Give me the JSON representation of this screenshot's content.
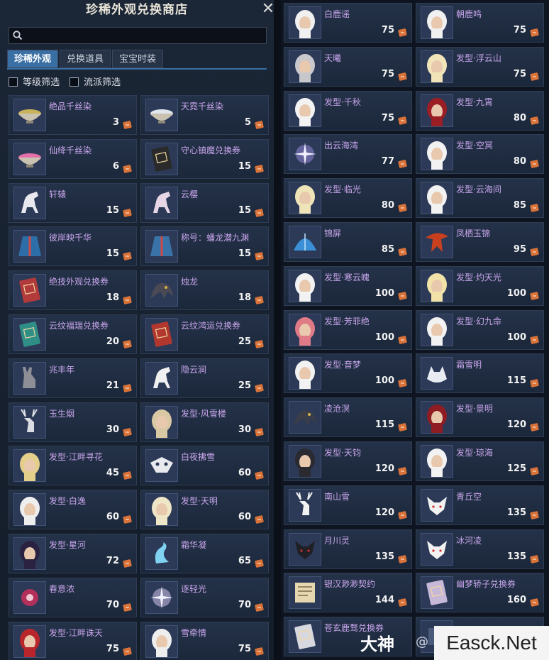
{
  "window": {
    "title": "珍稀外观兑换商店",
    "close_label": "✕"
  },
  "search": {
    "placeholder": ""
  },
  "tabs": [
    {
      "label": "珍稀外观",
      "active": true
    },
    {
      "label": "兑换道具",
      "active": false
    },
    {
      "label": "宝宝时装",
      "active": false
    }
  ],
  "filters": [
    {
      "label": "等级筛选",
      "checked": false
    },
    {
      "label": "流派筛选",
      "checked": false
    }
  ],
  "currency_icon": "ticket-icon",
  "left_items": [
    {
      "name": "绝品千丝染",
      "price": "3",
      "icon": "dye-bowl-icon",
      "color": "#c9b35a"
    },
    {
      "name": "天霓千丝染",
      "price": "5",
      "icon": "dye-bowl-icon",
      "color": "#dfe6ec"
    },
    {
      "name": "仙绛千丝染",
      "price": "6",
      "icon": "dye-bowl-icon",
      "color": "#e56fa8"
    },
    {
      "name": "守心镇魔兑换券",
      "price": "15",
      "icon": "coupon-icon",
      "color": "#2a2a2a"
    },
    {
      "name": "轩辕",
      "price": "15",
      "icon": "horse-icon",
      "color": "#e8e8ee"
    },
    {
      "name": "云樱",
      "price": "15",
      "icon": "horse-icon",
      "color": "#e6d6e6"
    },
    {
      "name": "彼岸映千华",
      "price": "15",
      "icon": "robe-icon",
      "color": "#2d6ea8"
    },
    {
      "name": "称号：蟠龙潜九渊",
      "price": "15",
      "icon": "robe-icon",
      "color": "#3a73a8"
    },
    {
      "name": "绝技外观兑换券",
      "price": "18",
      "icon": "coupon-icon",
      "color": "#b23a3a"
    },
    {
      "name": "烛龙",
      "price": "18",
      "icon": "dragon-icon",
      "color": "#4a4a55"
    },
    {
      "name": "云纹福瑞兑换券",
      "price": "20",
      "icon": "coupon-icon",
      "color": "#2f8f86"
    },
    {
      "name": "云纹鸿运兑换券",
      "price": "25",
      "icon": "coupon-icon",
      "color": "#b2382f"
    },
    {
      "name": "兆丰年",
      "price": "21",
      "icon": "donkey-icon",
      "color": "#8e8e96"
    },
    {
      "name": "隐云涧",
      "price": "25",
      "icon": "horse-icon",
      "color": "#f0f0f0"
    },
    {
      "name": "玉生烟",
      "price": "30",
      "icon": "deer-icon",
      "color": "#dcdde4"
    },
    {
      "name": "发型·风雪楼",
      "price": "30",
      "icon": "hair-icon",
      "color": "#d8c9a4"
    },
    {
      "name": "发型·江畔寻花",
      "price": "45",
      "icon": "hair-icon",
      "color": "#e3cf8a"
    },
    {
      "name": "白夜拂雪",
      "price": "60",
      "icon": "mask-icon",
      "color": "#e9eaee"
    },
    {
      "name": "发型·白逸",
      "price": "60",
      "icon": "hair-icon",
      "color": "#eeeeee"
    },
    {
      "name": "发型·天明",
      "price": "60",
      "icon": "hair-icon",
      "color": "#efe6c8"
    },
    {
      "name": "发型·星河",
      "price": "72",
      "icon": "hair-icon",
      "color": "#2a2240"
    },
    {
      "name": "霜华凝",
      "price": "65",
      "icon": "swan-icon",
      "color": "#7fd3f0"
    },
    {
      "name": "春意浓",
      "price": "70",
      "icon": "flower-icon",
      "color": "#b3305a"
    },
    {
      "name": "逐轻光",
      "price": "70",
      "icon": "sparkle-icon",
      "color": "#c3b8dc"
    },
    {
      "name": "发型·江畔诛天",
      "price": "75",
      "icon": "hair-icon",
      "color": "#b8262c"
    },
    {
      "name": "雪牵情",
      "price": "75",
      "icon": "hair-icon",
      "color": "#eeeeee"
    }
  ],
  "right_items": [
    {
      "name": "白鹿谣",
      "price": "75",
      "icon": "hair-icon",
      "color": "#f0f0f0"
    },
    {
      "name": "朝鹿鸣",
      "price": "75",
      "icon": "hair-icon",
      "color": "#f0f0f0"
    },
    {
      "name": "天曦",
      "price": "75",
      "icon": "hair-icon",
      "color": "#c8c8cc"
    },
    {
      "name": "发型·浮云山",
      "price": "75",
      "icon": "hair-icon",
      "color": "#f0e4b8"
    },
    {
      "name": "发型·千秋",
      "price": "75",
      "icon": "hair-icon",
      "color": "#f2f2f2"
    },
    {
      "name": "发型·九霄",
      "price": "80",
      "icon": "hair-icon",
      "color": "#9a1e24"
    },
    {
      "name": "出云海湾",
      "price": "77",
      "icon": "sparkle-icon",
      "color": "#8a7fc8"
    },
    {
      "name": "发型·空冥",
      "price": "80",
      "icon": "hair-icon",
      "color": "#f2f2f2"
    },
    {
      "name": "发型·临光",
      "price": "80",
      "icon": "hair-icon",
      "color": "#efe4b8"
    },
    {
      "name": "发型·云海间",
      "price": "85",
      "icon": "hair-icon",
      "color": "#f2f2f2"
    },
    {
      "name": "锦屏",
      "price": "85",
      "icon": "fan-icon",
      "color": "#3b8fd6"
    },
    {
      "name": "凤栖玉锦",
      "price": "95",
      "icon": "phoenix-icon",
      "color": "#c8401e"
    },
    {
      "name": "发型·寒云魄",
      "price": "100",
      "icon": "hair-icon",
      "color": "#f2f2f2"
    },
    {
      "name": "发型·灼天光",
      "price": "100",
      "icon": "hair-icon",
      "color": "#f1e2a8"
    },
    {
      "name": "发型·芳菲绝",
      "price": "100",
      "icon": "hair-icon",
      "color": "#e07a86"
    },
    {
      "name": "发型·幻九命",
      "price": "100",
      "icon": "hair-icon",
      "color": "#f2f2f2"
    },
    {
      "name": "发型·音梦",
      "price": "100",
      "icon": "hair-icon",
      "color": "#f2f2f2"
    },
    {
      "name": "霜雪明",
      "price": "115",
      "icon": "wolf-icon",
      "color": "#e8ecf2"
    },
    {
      "name": "凌沧溟",
      "price": "115",
      "icon": "dragon-icon",
      "color": "#3a3d4a"
    },
    {
      "name": "发型·景明",
      "price": "120",
      "icon": "hair-icon",
      "color": "#8e1c22"
    },
    {
      "name": "发型·天钧",
      "price": "120",
      "icon": "hair-icon",
      "color": "#2a2a30"
    },
    {
      "name": "发型·琼海",
      "price": "125",
      "icon": "hair-icon",
      "color": "#f2f2f2"
    },
    {
      "name": "南山雪",
      "price": "120",
      "icon": "deer-icon",
      "color": "#f2f2f2"
    },
    {
      "name": "青丘空",
      "price": "135",
      "icon": "fox-icon",
      "color": "#f2f2f2"
    },
    {
      "name": "月川灵",
      "price": "135",
      "icon": "fox-icon",
      "color": "#1f1f26"
    },
    {
      "name": "冰河凌",
      "price": "135",
      "icon": "fox-icon",
      "color": "#f2f2f2"
    },
    {
      "name": "银汉渺渺契约",
      "price": "144",
      "icon": "scroll-icon",
      "color": "#e6d7b0"
    },
    {
      "name": "幽梦轿子兑换券",
      "price": "160",
      "icon": "coupon-icon",
      "color": "#c7b8d8"
    },
    {
      "name": "苍玄鹿骛兑换券",
      "price": "",
      "icon": "coupon-icon",
      "color": "#d8d8e0"
    },
    {
      "name": "",
      "price": "",
      "icon": "item-icon",
      "color": "#4a5a7a"
    }
  ],
  "watermark": {
    "brand": "大神",
    "at": "@",
    "site": "Easck.Net"
  }
}
